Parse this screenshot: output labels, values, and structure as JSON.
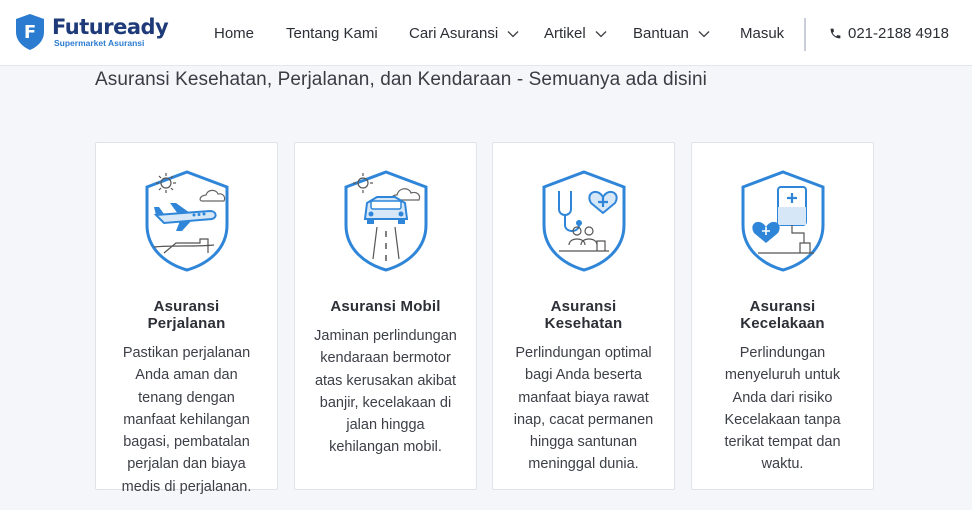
{
  "brand": {
    "name": "Futuready",
    "tagline": "Supermarket Asuransi",
    "badge_letter": "F"
  },
  "nav": {
    "items": [
      {
        "label": "Home",
        "dropdown": false
      },
      {
        "label": "Tentang Kami",
        "dropdown": false
      },
      {
        "label": "Cari Asuransi",
        "dropdown": true
      },
      {
        "label": "Artikel",
        "dropdown": true
      },
      {
        "label": "Bantuan",
        "dropdown": true
      },
      {
        "label": "Masuk",
        "dropdown": false
      }
    ],
    "phone": "021-2188 4918",
    "phone_icon": "phone-icon"
  },
  "hero": {
    "subtitle": "Asuransi Kesehatan, Perjalanan, dan Kendaraan - Semuanya ada disini"
  },
  "cards": [
    {
      "icon": "travel-shield-icon",
      "title_line1": "Asuransi",
      "title_line2": "Perjalanan",
      "desc": [
        "Pastikan perjalanan",
        "Anda aman dan",
        "tenang dengan",
        "manfaat kehilangan",
        "bagasi, pembatalan",
        "perjalan dan biaya",
        "medis di perjalanan."
      ]
    },
    {
      "icon": "car-shield-icon",
      "title_line1": "Asuransi Mobil",
      "title_line2": "",
      "desc": [
        "Jaminan perlindungan",
        "kendaraan bermotor",
        "atas kerusakan akibat",
        "banjir, kecelakaan di",
        "jalan hingga",
        "kehilangan mobil."
      ]
    },
    {
      "icon": "health-shield-icon",
      "title_line1": "Asuransi",
      "title_line2": "Kesehatan",
      "desc": [
        "Perlindungan optimal",
        "bagi Anda beserta",
        "manfaat biaya rawat",
        "inap, cacat permanen",
        "hingga santunan",
        "meninggal dunia."
      ]
    },
    {
      "icon": "accident-shield-icon",
      "title_line1": "Asuransi",
      "title_line2": "Kecelakaan",
      "desc": [
        "Perlindungan",
        "menyeluruh untuk",
        "Anda dari risiko",
        "Kecelakaan tanpa",
        "terikat tempat dan",
        "waktu."
      ]
    }
  ],
  "colors": {
    "brand_navy": "#1e3a78",
    "brand_blue": "#2b7bd0",
    "icon_blue": "#2f86d8",
    "page_bg": "#f4f6fa"
  }
}
